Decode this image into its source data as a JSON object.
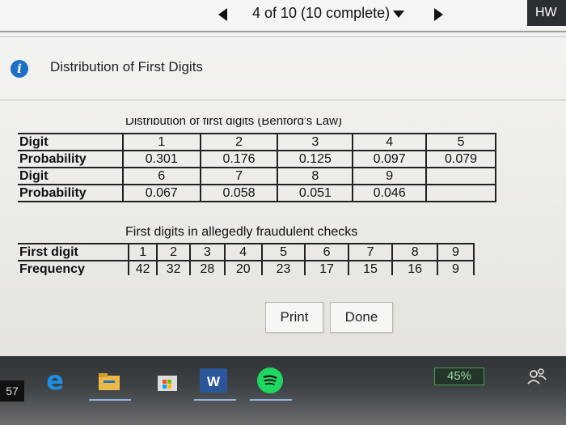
{
  "header": {
    "progress": "4 of 10 (10 complete)",
    "hw_label": "HW"
  },
  "info": {
    "title": "Distribution of First Digits"
  },
  "benford": {
    "caption": "Distribution of first digits (Benford's Law)",
    "rows": [
      {
        "label": "Digit",
        "cells": [
          "1",
          "2",
          "3",
          "4",
          "5"
        ]
      },
      {
        "label": "Probability",
        "cells": [
          "0.301",
          "0.176",
          "0.125",
          "0.097",
          "0.079"
        ]
      },
      {
        "label": "Digit",
        "cells": [
          "6",
          "7",
          "8",
          "9",
          ""
        ]
      },
      {
        "label": "Probability",
        "cells": [
          "0.067",
          "0.058",
          "0.051",
          "0.046",
          ""
        ]
      }
    ]
  },
  "checks": {
    "caption": "First digits in allegedly fraudulent checks",
    "rows": [
      {
        "label": "First digit",
        "cells": [
          "1",
          "2",
          "3",
          "4",
          "5",
          "6",
          "7",
          "8",
          "9"
        ]
      },
      {
        "label": "Frequency",
        "cells": [
          "42",
          "32",
          "28",
          "20",
          "23",
          "17",
          "15",
          "16",
          "9"
        ]
      }
    ]
  },
  "buttons": {
    "print": "Print",
    "done": "Done"
  },
  "taskbar": {
    "clock_fragment": "57",
    "battery": "45%",
    "word_letter": "W"
  }
}
